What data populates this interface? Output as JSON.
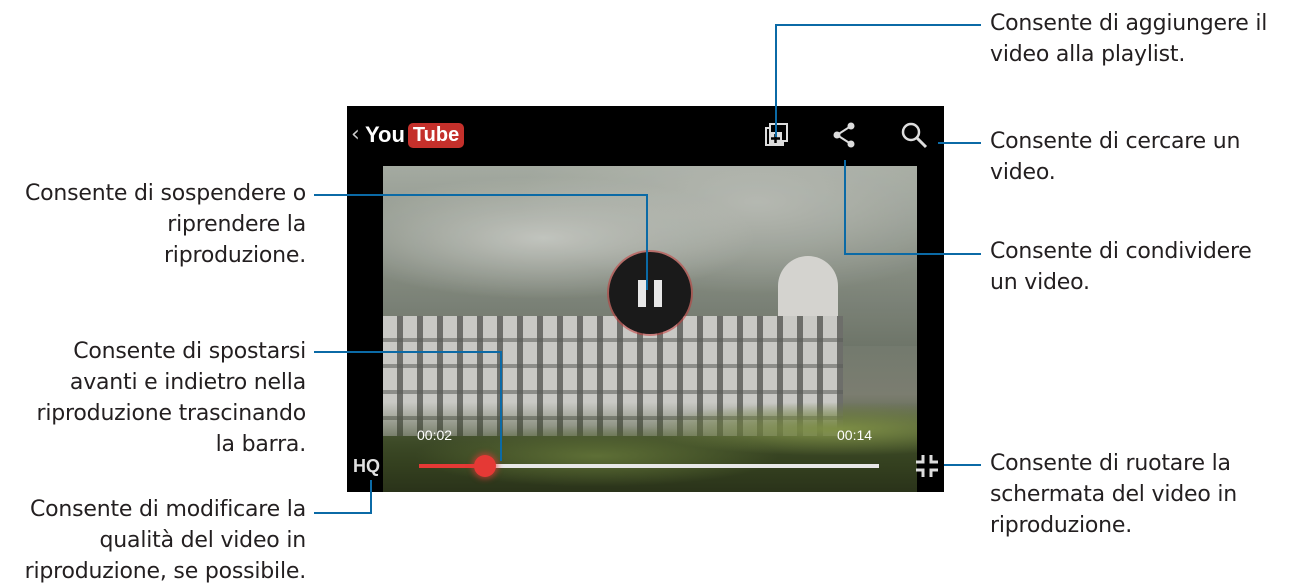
{
  "callouts": {
    "playlist": "Consente di aggiungere il\nvideo alla playlist.",
    "search": "Consente di cercare un\nvideo.",
    "pause": "Consente di sospendere o\nriprendere la\nriproduzione.",
    "share": "Consente di condividere\nun video.",
    "seek": "Consente di spostarsi\navanti e indietro nella\nriproduzione trascinando\nla barra.",
    "rotate": "Consente di ruotare la\nschermata del video in\nriproduzione.",
    "quality": "Consente di modificare la\nqualità del video in\nriproduzione, se possibile."
  },
  "player": {
    "logo_you": "You",
    "logo_tube": "Tube",
    "elapsed": "00:02",
    "duration": "00:14",
    "quality_label": "HQ",
    "progress_fraction": 0.143
  },
  "icons": {
    "back": "chevron-left-icon",
    "playlist": "add-to-playlist-icon",
    "share": "share-icon",
    "search": "search-icon",
    "pause": "pause-icon",
    "rotate": "rotate-screen-icon"
  },
  "colors": {
    "leader": "#0b6aa6",
    "progress": "#e53935",
    "youtube_red": "#c4302b"
  }
}
